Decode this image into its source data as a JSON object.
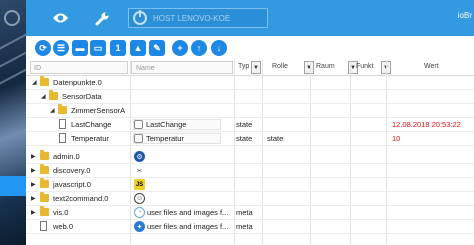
{
  "header": {
    "host_text": "HOST LENOVO-KOE",
    "right_text": "ioBr"
  },
  "columns": {
    "id": "ID",
    "name": "Name",
    "type": "Typ",
    "role": "Rolle",
    "room": "Raum",
    "function": "Funkt",
    "value": "Wert"
  },
  "rows": [
    {
      "label": "Datenpunkte.0",
      "name": "",
      "type": "",
      "role": "",
      "value": ""
    },
    {
      "label": "SensorData",
      "name": "",
      "type": "",
      "role": "",
      "value": ""
    },
    {
      "label": "ZimmerSensorA",
      "name": "",
      "type": "",
      "role": "",
      "value": ""
    },
    {
      "label": "LastChange",
      "name": "LastChange",
      "type": "state",
      "role": "",
      "value": "12.08.2018 20:53:22"
    },
    {
      "label": "Temperatur",
      "name": "Temperatur",
      "type": "state",
      "role": "state",
      "value": "10"
    },
    {
      "label": "admin.0",
      "name": "",
      "type": "",
      "role": "",
      "value": ""
    },
    {
      "label": "discovery.0",
      "name": "",
      "type": "",
      "role": "",
      "value": ""
    },
    {
      "label": "javascript.0",
      "name": "",
      "type": "",
      "role": "",
      "value": ""
    },
    {
      "label": "text2command.0",
      "name": "",
      "type": "",
      "role": "",
      "value": ""
    },
    {
      "label": "vis.0",
      "name": "user files and images f...",
      "type": "meta",
      "role": "",
      "value": ""
    },
    {
      "label": "web.0",
      "name": "user files and images f...",
      "type": "meta",
      "role": "",
      "value": ""
    }
  ],
  "icons": [
    "eye-icon",
    "wrench-icon",
    "refresh-icon",
    "list-icon",
    "folder-icon",
    "folder-open-icon",
    "number-1-icon",
    "image-icon",
    "edit-icon",
    "plus-icon",
    "upload-icon",
    "download-icon"
  ],
  "colors": {
    "header": "#3399e0",
    "accent": "#1e88e5",
    "value_red": "#e01010"
  }
}
